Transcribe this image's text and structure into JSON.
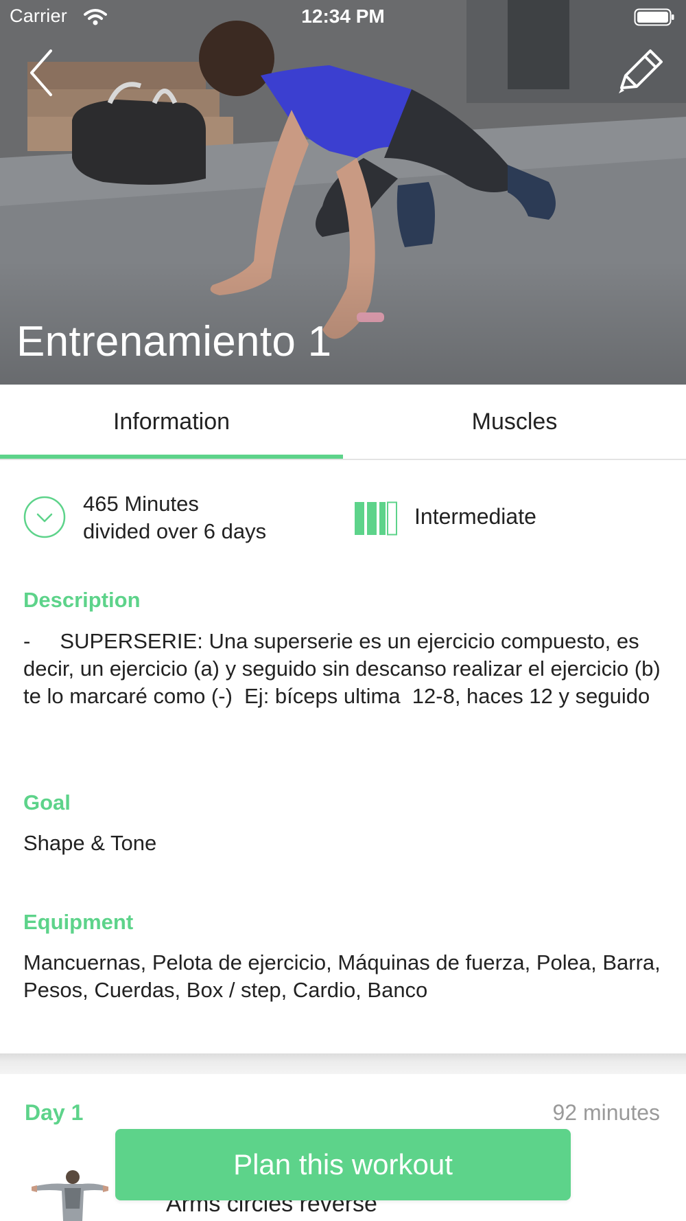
{
  "status_bar": {
    "carrier": "Carrier",
    "time": "12:34 PM"
  },
  "hero": {
    "title": "Entrenamiento 1",
    "back_icon": "chevron-left-icon",
    "edit_icon": "pencil-icon"
  },
  "tabs": [
    {
      "label": "Information",
      "selected": true
    },
    {
      "label": "Muscles",
      "selected": false
    }
  ],
  "summary": {
    "duration_line1": "465 Minutes",
    "duration_line2": "divided over 6 days",
    "level": "Intermediate",
    "level_bars_filled": 3,
    "level_bars_total": 4
  },
  "description": {
    "heading": "Description",
    "body": "-     SUPERSERIE: Una superserie es un ejercicio compuesto, es decir, un ejercicio (a) y seguido sin descanso realizar el ejercicio (b) te lo marcaré como (-)  Ej: bíceps ultima  12-8, haces 12 y seguido"
  },
  "goal": {
    "heading": "Goal",
    "body": "Shape & Tone"
  },
  "equipment": {
    "heading": "Equipment",
    "body": "Mancuernas, Pelota de ejercicio, Máquinas de fuerza, Polea, Barra, Pesos, Cuerdas, Box / step, Cardio, Banco"
  },
  "day": {
    "title": "Day 1",
    "minutes": "92 minutes",
    "first_exercise": "Arms circles reverse"
  },
  "cta": {
    "label": "Plan this workout"
  },
  "colors": {
    "accent": "#5dd38a",
    "text": "#222222",
    "muted": "#9a9a9a"
  }
}
